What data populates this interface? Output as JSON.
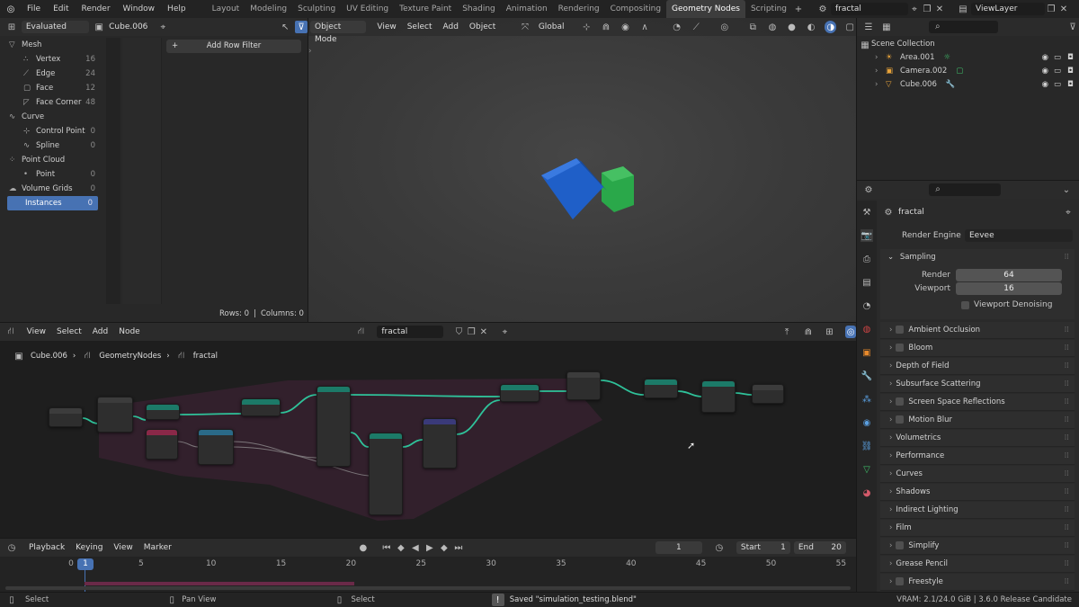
{
  "menubar": {
    "items": [
      "File",
      "Edit",
      "Render",
      "Window",
      "Help"
    ]
  },
  "workspaces": {
    "tabs": [
      "Layout",
      "Modeling",
      "Sculpting",
      "UV Editing",
      "Texture Paint",
      "Shading",
      "Animation",
      "Rendering",
      "Compositing",
      "Geometry Nodes",
      "Scripting"
    ],
    "active": "Geometry Nodes"
  },
  "scene": {
    "name": "fractal",
    "view_layer": "ViewLayer"
  },
  "spreadsheet": {
    "mode": "Evaluated",
    "object": "Cube.006",
    "add_row_filter": "Add Row Filter",
    "footer": {
      "rows": "Rows: 0",
      "separator": "|",
      "columns": "Columns: 0"
    },
    "items": [
      {
        "label": "Mesh",
        "count": ""
      },
      {
        "label": "Vertex",
        "count": "16"
      },
      {
        "label": "Edge",
        "count": "24"
      },
      {
        "label": "Face",
        "count": "12"
      },
      {
        "label": "Face Corner",
        "count": "48"
      },
      {
        "label": "Curve",
        "count": ""
      },
      {
        "label": "Control Point",
        "count": "0"
      },
      {
        "label": "Spline",
        "count": "0"
      },
      {
        "label": "Point Cloud",
        "count": ""
      },
      {
        "label": "Point",
        "count": "0"
      },
      {
        "label": "Volume Grids",
        "count": "0"
      },
      {
        "label": "Instances",
        "count": "0"
      }
    ]
  },
  "viewport": {
    "mode": "Object Mode",
    "menus": [
      "View",
      "Select",
      "Add",
      "Object"
    ],
    "orientation": "Global"
  },
  "outliner": {
    "root": "Scene Collection",
    "items": [
      "Area.001",
      "Camera.002",
      "Cube.006"
    ]
  },
  "properties": {
    "datablock": "fractal",
    "render_engine_label": "Render Engine",
    "render_engine": "Eevee",
    "sampling": {
      "title": "Sampling",
      "render_label": "Render",
      "render_value": "64",
      "viewport_label": "Viewport",
      "viewport_value": "16",
      "denoise_label": "Viewport Denoising"
    },
    "sections": [
      {
        "label": "Ambient Occlusion",
        "check": true
      },
      {
        "label": "Bloom",
        "check": true
      },
      {
        "label": "Depth of Field",
        "check": false
      },
      {
        "label": "Subsurface Scattering",
        "check": false
      },
      {
        "label": "Screen Space Reflections",
        "check": true
      },
      {
        "label": "Motion Blur",
        "check": true
      },
      {
        "label": "Volumetrics",
        "check": false
      },
      {
        "label": "Performance",
        "check": false
      },
      {
        "label": "Curves",
        "check": false
      },
      {
        "label": "Shadows",
        "check": false
      },
      {
        "label": "Indirect Lighting",
        "check": false
      },
      {
        "label": "Film",
        "check": false
      },
      {
        "label": "Simplify",
        "check": true
      },
      {
        "label": "Grease Pencil",
        "check": false
      },
      {
        "label": "Freestyle",
        "check": true
      }
    ]
  },
  "node_editor": {
    "menus": [
      "View",
      "Select",
      "Add",
      "Node"
    ],
    "tree_name": "fractal",
    "breadcrumb": [
      "Cube.006",
      "GeometryNodes",
      "fractal"
    ]
  },
  "timeline": {
    "menus": [
      "Playback",
      "Keying",
      "View",
      "Marker"
    ],
    "current_frame": "1",
    "start_label": "Start",
    "start": "1",
    "end_label": "End",
    "end": "20",
    "ticks": [
      "0",
      "5",
      "10",
      "15",
      "20",
      "25",
      "30",
      "35",
      "40",
      "45",
      "50",
      "55"
    ]
  },
  "statusbar": {
    "left_select": "Select",
    "pan": "Pan View",
    "select2": "Select",
    "message": "Saved \"simulation_testing.blend\"",
    "info": "VRAM: 2.1/24.0 GiB | 3.6.0 Release Candidate"
  },
  "colors": {
    "accent": "#4772b3",
    "active_tab_bg": "#3d3d3d",
    "node_link": "#2fc29a",
    "frame_tint": "#4a2a3a",
    "cube_blue": "#1f5fc8",
    "cube_green": "#2aa84a"
  }
}
